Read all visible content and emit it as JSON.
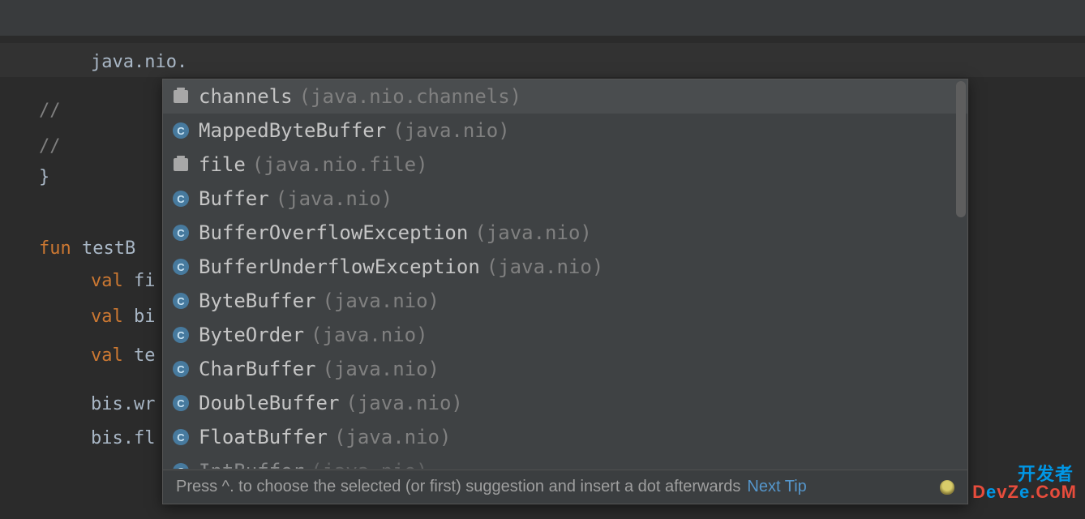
{
  "code": {
    "line1": "java.nio.",
    "line2_prefix": "//",
    "line3_prefix": "//",
    "line4": "}",
    "line5_keyword": "fun",
    "line5_rest": " testB",
    "line6_keyword": "val",
    "line6_rest": " fi",
    "line7_keyword": "val",
    "line7_rest": " bi",
    "line8_keyword": "val",
    "line8_rest": " te",
    "line9": "bis.wr",
    "line10": "bis.fl"
  },
  "completion": {
    "items": [
      {
        "icon": "package",
        "name": "channels",
        "pkg": "(java.nio.channels)",
        "selected": true
      },
      {
        "icon": "class",
        "name": "MappedByteBuffer",
        "pkg": "(java.nio)"
      },
      {
        "icon": "package",
        "name": "file",
        "pkg": "(java.nio.file)"
      },
      {
        "icon": "class",
        "name": "Buffer",
        "pkg": "(java.nio)"
      },
      {
        "icon": "class",
        "name": "BufferOverflowException",
        "pkg": "(java.nio)"
      },
      {
        "icon": "class",
        "name": "BufferUnderflowException",
        "pkg": "(java.nio)"
      },
      {
        "icon": "class",
        "name": "ByteBuffer",
        "pkg": "(java.nio)"
      },
      {
        "icon": "class",
        "name": "ByteOrder",
        "pkg": "(java.nio)"
      },
      {
        "icon": "class",
        "name": "CharBuffer",
        "pkg": "(java.nio)"
      },
      {
        "icon": "class",
        "name": "DoubleBuffer",
        "pkg": "(java.nio)"
      },
      {
        "icon": "class",
        "name": "FloatBuffer",
        "pkg": "(java.nio)"
      },
      {
        "icon": "class",
        "name": "IntBuffer",
        "pkg": "(java.nio)",
        "partial": true
      }
    ],
    "hint": "Press ^. to choose the selected (or first) suggestion and insert a dot afterwards",
    "nextTip": "Next Tip"
  },
  "watermark": {
    "line1": "开发者",
    "line2_pre": "D",
    "line2_e": "e",
    "line2_mid": "vZ",
    "line2_e2": "e",
    "line2_post": ".CoM"
  }
}
